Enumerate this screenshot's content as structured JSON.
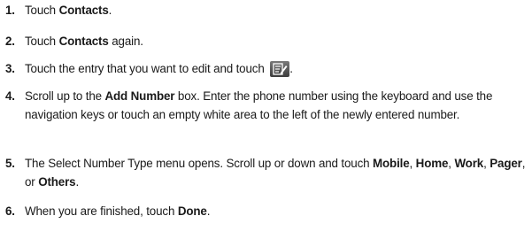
{
  "steps": [
    {
      "num": "1.",
      "parts": [
        {
          "t": "Touch "
        },
        {
          "t": "Contacts",
          "b": true
        },
        {
          "t": "."
        }
      ]
    },
    {
      "num": "2.",
      "parts": [
        {
          "t": "Touch "
        },
        {
          "t": "Contacts",
          "b": true
        },
        {
          "t": " again."
        }
      ]
    },
    {
      "num": "3.",
      "parts": [
        {
          "t": "Touch the entry that you want to edit and touch "
        },
        {
          "icon": "edit-icon"
        },
        {
          "t": "."
        }
      ]
    },
    {
      "num": "4.",
      "parts": [
        {
          "t": "Scroll up to the "
        },
        {
          "t": "Add Number",
          "b": true
        },
        {
          "t": " box. Enter the phone number using the keyboard and use the navigation keys or touch an empty white area to the left of the newly entered number."
        }
      ]
    },
    {
      "num": "5.",
      "parts": [
        {
          "t": "The Select Number Type menu opens. Scroll up or down and touch "
        },
        {
          "t": "Mobile",
          "b": true
        },
        {
          "t": ", "
        },
        {
          "t": "Home",
          "b": true
        },
        {
          "t": ", "
        },
        {
          "t": "Work",
          "b": true
        },
        {
          "t": ", "
        },
        {
          "t": "Pager",
          "b": true
        },
        {
          "t": ", or "
        },
        {
          "t": "Others",
          "b": true
        },
        {
          "t": "."
        }
      ]
    },
    {
      "num": "6.",
      "parts": [
        {
          "t": "When you are finished, touch "
        },
        {
          "t": "Done",
          "b": true
        },
        {
          "t": "."
        }
      ]
    }
  ]
}
